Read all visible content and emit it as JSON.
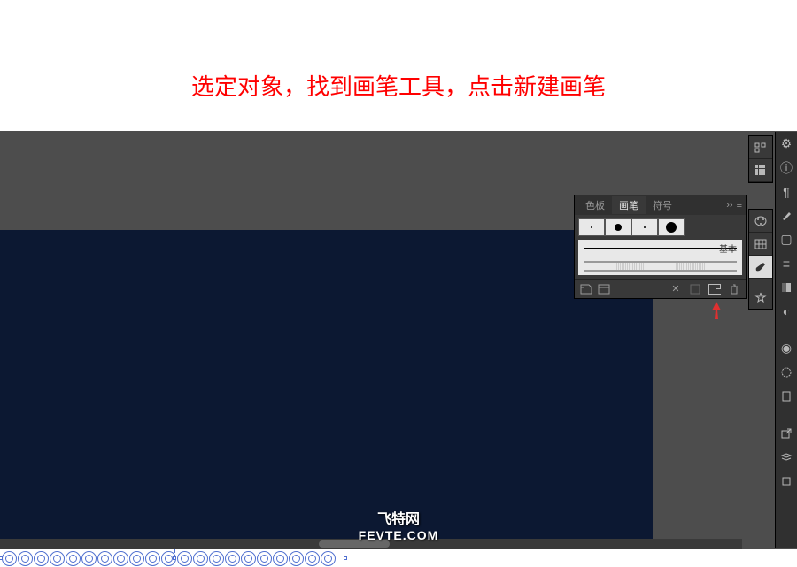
{
  "instruction": "选定对象，找到画笔工具，点击新建画笔",
  "panel": {
    "tabs": {
      "swatches": "色板",
      "brushes": "画笔",
      "symbols": "符号"
    },
    "basic_label": "基本",
    "menu_arrow": "››"
  },
  "watermark": {
    "cn": "飞特网",
    "en": "FEVTE.COM"
  },
  "icons": {
    "stroke": "#aaa"
  }
}
